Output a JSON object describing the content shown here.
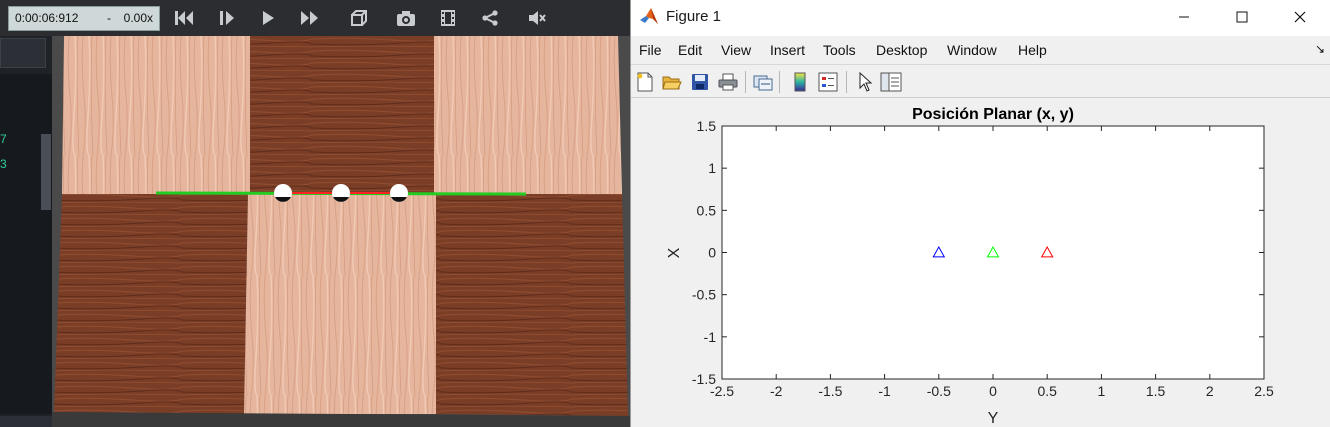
{
  "player": {
    "time": "0:00:06:912",
    "separator": "-",
    "rate": "0.00x",
    "side_numbers": [
      "7",
      "3"
    ],
    "buttons": [
      "skip-to-start-icon",
      "frame-step-icon",
      "play-icon",
      "fast-forward-icon",
      "3d-view-icon",
      "camera-icon",
      "film-icon",
      "share-icon",
      "mute-icon"
    ],
    "markers": {
      "colors": [
        "#ffffff",
        "#ffffff",
        "#ffffff"
      ],
      "line_color": "#22cc22",
      "link_color": "#ff2222"
    }
  },
  "figure": {
    "window_title": "Figure 1",
    "menu": [
      "File",
      "Edit",
      "View",
      "Insert",
      "Tools",
      "Desktop",
      "Window",
      "Help"
    ],
    "toolbar_icons": [
      "new-figure-icon",
      "open-icon",
      "save-icon",
      "print-icon",
      "link-plot-icon",
      "colorbar-icon",
      "legend-icon",
      "pointer-icon",
      "property-inspector-icon"
    ]
  },
  "chart_data": {
    "type": "scatter",
    "title": "Posición Planar (x, y)",
    "xlabel": "Y",
    "ylabel": "X",
    "xlim": [
      -2.5,
      2.5
    ],
    "ylim": [
      -1.5,
      1.5
    ],
    "xticks": [
      "-2.5",
      "-2",
      "-1.5",
      "-1",
      "-0.5",
      "0",
      "0.5",
      "1",
      "1.5",
      "2",
      "2.5"
    ],
    "yticks": [
      "1.5",
      "1",
      "0.5",
      "0",
      "-0.5",
      "-1",
      "-1.5"
    ],
    "marker": "triangle",
    "grid": false,
    "points": [
      {
        "x": -0.5,
        "y": 0,
        "color": "#0000ff"
      },
      {
        "x": 0,
        "y": 0,
        "color": "#00ff00"
      },
      {
        "x": 0.5,
        "y": 0,
        "color": "#ff0000"
      }
    ]
  }
}
